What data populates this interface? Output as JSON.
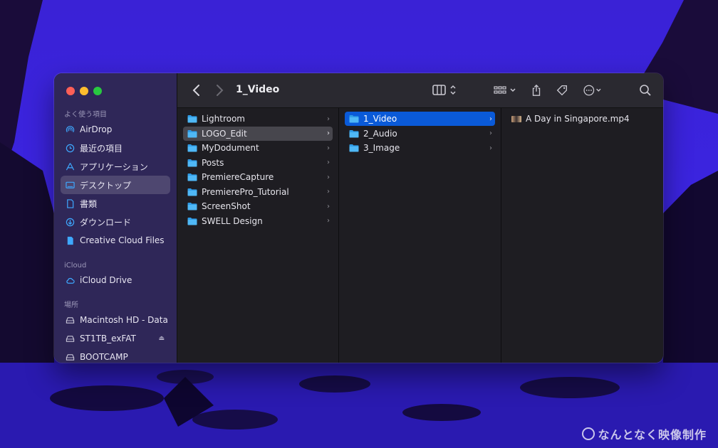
{
  "window": {
    "title": "1_Video"
  },
  "sidebar": {
    "favorites_header": "よく使う項目",
    "favorites": [
      {
        "label": "AirDrop",
        "icon": "airdrop-icon"
      },
      {
        "label": "最近の項目",
        "icon": "clock-icon"
      },
      {
        "label": "アプリケーション",
        "icon": "applications-icon"
      },
      {
        "label": "デスクトップ",
        "icon": "desktop-icon",
        "selected": true
      },
      {
        "label": "書類",
        "icon": "document-icon"
      },
      {
        "label": "ダウンロード",
        "icon": "download-icon"
      },
      {
        "label": "Creative Cloud Files",
        "icon": "file-icon"
      }
    ],
    "icloud_header": "iCloud",
    "icloud": [
      {
        "label": "iCloud Drive",
        "icon": "cloud-icon"
      }
    ],
    "locations_header": "場所",
    "locations": [
      {
        "label": "Macintosh HD - Data",
        "icon": "disk-icon"
      },
      {
        "label": "ST1TB_exFAT",
        "icon": "disk-icon",
        "eject": true
      },
      {
        "label": "BOOTCAMP",
        "icon": "disk-icon"
      }
    ]
  },
  "columns": {
    "col1": [
      "Lightroom",
      "LOGO_Edit",
      "MyDodument",
      "Posts",
      "PremiereCapture",
      "PremierePro_Tutorial",
      "ScreenShot",
      "SWELL Design"
    ],
    "col1_selected": 1,
    "col2": [
      "1_Video",
      "2_Audio",
      "3_Image"
    ],
    "col2_selected": 0,
    "col3": [
      "A Day in Singapore.mp4"
    ]
  },
  "watermark": "なんとなく映像制作",
  "colors": {
    "accent": "#0a5ad8",
    "folder": "#38a8f0",
    "wallpaper": "#3b1fd9"
  }
}
